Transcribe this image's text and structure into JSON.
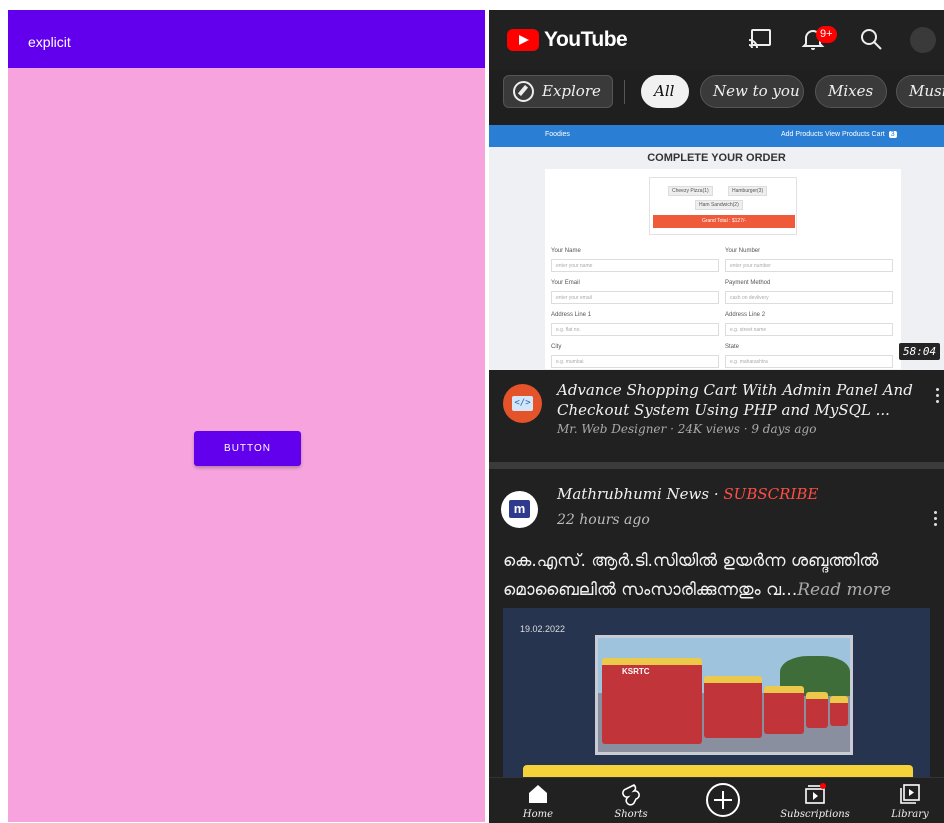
{
  "left_app": {
    "appbar_title": "explicit",
    "button_label": "BUTTON",
    "colors": {
      "appbar": "#6200ee",
      "background": "#f7a4de",
      "button": "#6200ee"
    }
  },
  "youtube": {
    "logo_text": "YouTube",
    "notification_badge": "9+",
    "icons": [
      "cast-icon",
      "bell-icon",
      "search-icon",
      "avatar"
    ],
    "chips": {
      "explore": "Explore",
      "all": "All",
      "new_to_you": "New to you",
      "mixes": "Mixes",
      "music": "Musi"
    },
    "video1": {
      "thumbnail": {
        "brand": "Foodies",
        "nav_links": "Add Products   View Products   Cart",
        "cart_count": "3",
        "heading": "COMPLETE YOUR ORDER",
        "items": [
          "Cheezy Pizza(1)",
          "Hamburger(3)",
          "Ham Sandwich(2)"
        ],
        "grand_total": "Grand Total : $127/-",
        "fields": [
          {
            "label": "Your Name",
            "placeholder": "enter your name"
          },
          {
            "label": "Your Number",
            "placeholder": "enter your number"
          },
          {
            "label": "Your Email",
            "placeholder": "enter your email"
          },
          {
            "label": "Payment Method",
            "placeholder": "cash on devlivery"
          },
          {
            "label": "Address Line 1",
            "placeholder": "e.g. flat no."
          },
          {
            "label": "Address Line 2",
            "placeholder": "e.g. street name"
          },
          {
            "label": "City",
            "placeholder": "e.g. mumbai"
          },
          {
            "label": "State",
            "placeholder": "e.g. maharashtra"
          }
        ]
      },
      "duration": "58:04",
      "title": "Advance Shopping Cart With Admin Panel And Checkout System Using PHP and MySQL ...",
      "meta": "Mr. Web Designer · 24K views · 9 days ago",
      "channel_avatar_text": "</>"
    },
    "post": {
      "channel": "Mathrubhumi News",
      "subscribe": "SUBSCRIBE",
      "time": "22 hours ago",
      "avatar_text": "m",
      "text": "കെ.എസ്. ആർ.ടി.സിയിൽ ഉയർന്ന ശബ്ദത്തിൽ മൊബൈലിൽ സംസാരിക്കുന്നതും വ...",
      "read_more": "Read more",
      "image_date": "19.02.2022",
      "bus_sign": "KSRTC"
    },
    "bottom_nav": {
      "home": "Home",
      "shorts": "Shorts",
      "create": "",
      "subscriptions": "Subscriptions",
      "library": "Library"
    },
    "colors": {
      "brand_red": "#ff0000",
      "background": "#212121",
      "subscribe": "#ff4e45"
    }
  }
}
